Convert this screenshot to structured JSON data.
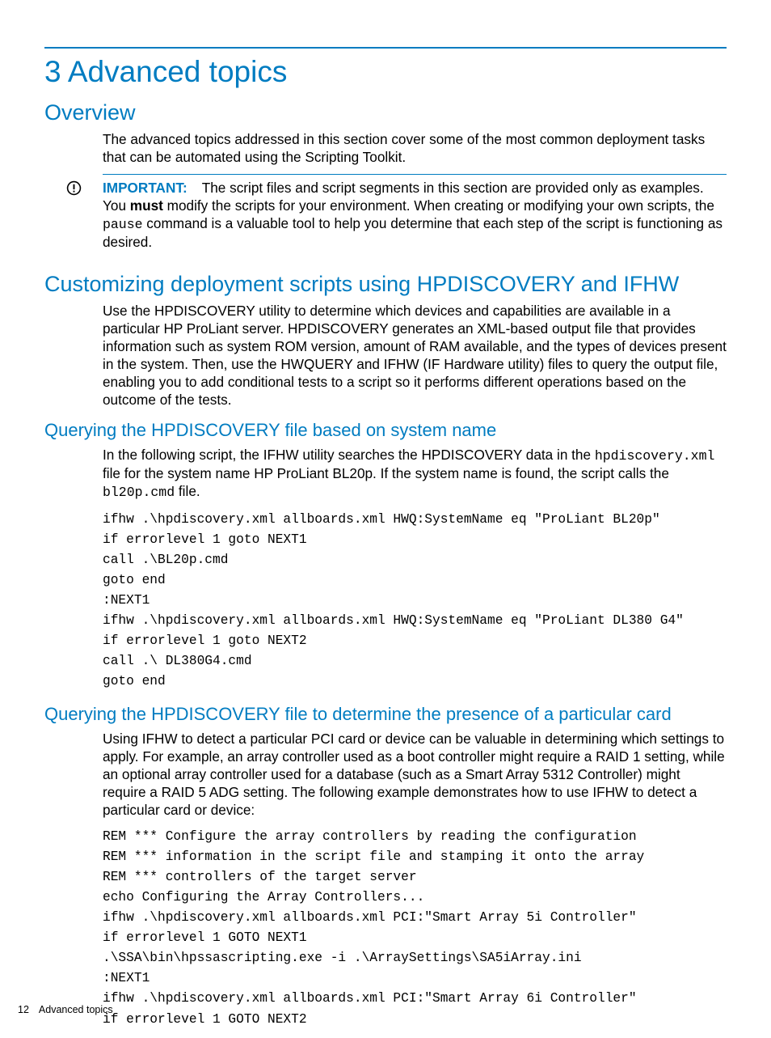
{
  "chapter": {
    "number": "3",
    "title": "3 Advanced topics"
  },
  "section_overview": {
    "heading": "Overview",
    "para": "The advanced topics addressed in this section cover some of the most common deployment tasks that can be automated using the Scripting Toolkit."
  },
  "callout": {
    "label": "IMPORTANT:",
    "text_before_bold": "The script files and script segments in this section are provided only as examples. You ",
    "bold_word": "must",
    "text_after_bold": " modify the scripts for your environment. When creating or modifying your own scripts, the ",
    "code_word": "pause",
    "text_after_code": " command is a valuable tool to help you determine that each step of the script is functioning as desired."
  },
  "section_customizing": {
    "heading": "Customizing deployment scripts using HPDISCOVERY and IFHW",
    "para": "Use the HPDISCOVERY utility to determine which devices and capabilities are available in a particular HP ProLiant server. HPDISCOVERY generates an XML-based output file that provides information such as system ROM version, amount of RAM available, and the types of devices present in the system. Then, use the HWQUERY and IFHW (IF Hardware utility) files to query the output file, enabling you to add conditional tests to a script so it performs different operations based on the outcome of the tests."
  },
  "section_query_name": {
    "heading": "Querying the HPDISCOVERY file based on system name",
    "para_pre": "In the following script, the IFHW utility searches the HPDISCOVERY data in the ",
    "code1": "hpdiscovery.xml",
    "para_mid": " file for the system name HP ProLiant BL20p. If the system name is found, the script calls the ",
    "code2": "bl20p.cmd",
    "para_post": " file.",
    "code": "ifhw .\\hpdiscovery.xml allboards.xml HWQ:SystemName eq \"ProLiant BL20p\"\nif errorlevel 1 goto NEXT1\ncall .\\BL20p.cmd\ngoto end\n:NEXT1\nifhw .\\hpdiscovery.xml allboards.xml HWQ:SystemName eq \"ProLiant DL380 G4\"\nif errorlevel 1 goto NEXT2\ncall .\\ DL380G4.cmd\ngoto end"
  },
  "section_query_card": {
    "heading": "Querying the HPDISCOVERY file to determine the presence of a particular card",
    "para": "Using IFHW to detect a particular PCI card or device can be valuable in determining which settings to apply. For example, an array controller used as a boot controller might require a RAID 1 setting, while an optional array controller used for a database (such as a Smart Array 5312 Controller) might require a RAID 5 ADG setting. The following example demonstrates how to use IFHW to detect a particular card or device:",
    "code": "REM *** Configure the array controllers by reading the configuration\nREM *** information in the script file and stamping it onto the array\nREM *** controllers of the target server\necho Configuring the Array Controllers...\nifhw .\\hpdiscovery.xml allboards.xml PCI:\"Smart Array 5i Controller\"\nif errorlevel 1 GOTO NEXT1\n.\\SSA\\bin\\hpssascripting.exe -i .\\ArraySettings\\SA5iArray.ini\n:NEXT1\nifhw .\\hpdiscovery.xml allboards.xml PCI:\"Smart Array 6i Controller\"\nif errorlevel 1 GOTO NEXT2"
  },
  "footer": {
    "page_number": "12",
    "section": "Advanced topics"
  }
}
